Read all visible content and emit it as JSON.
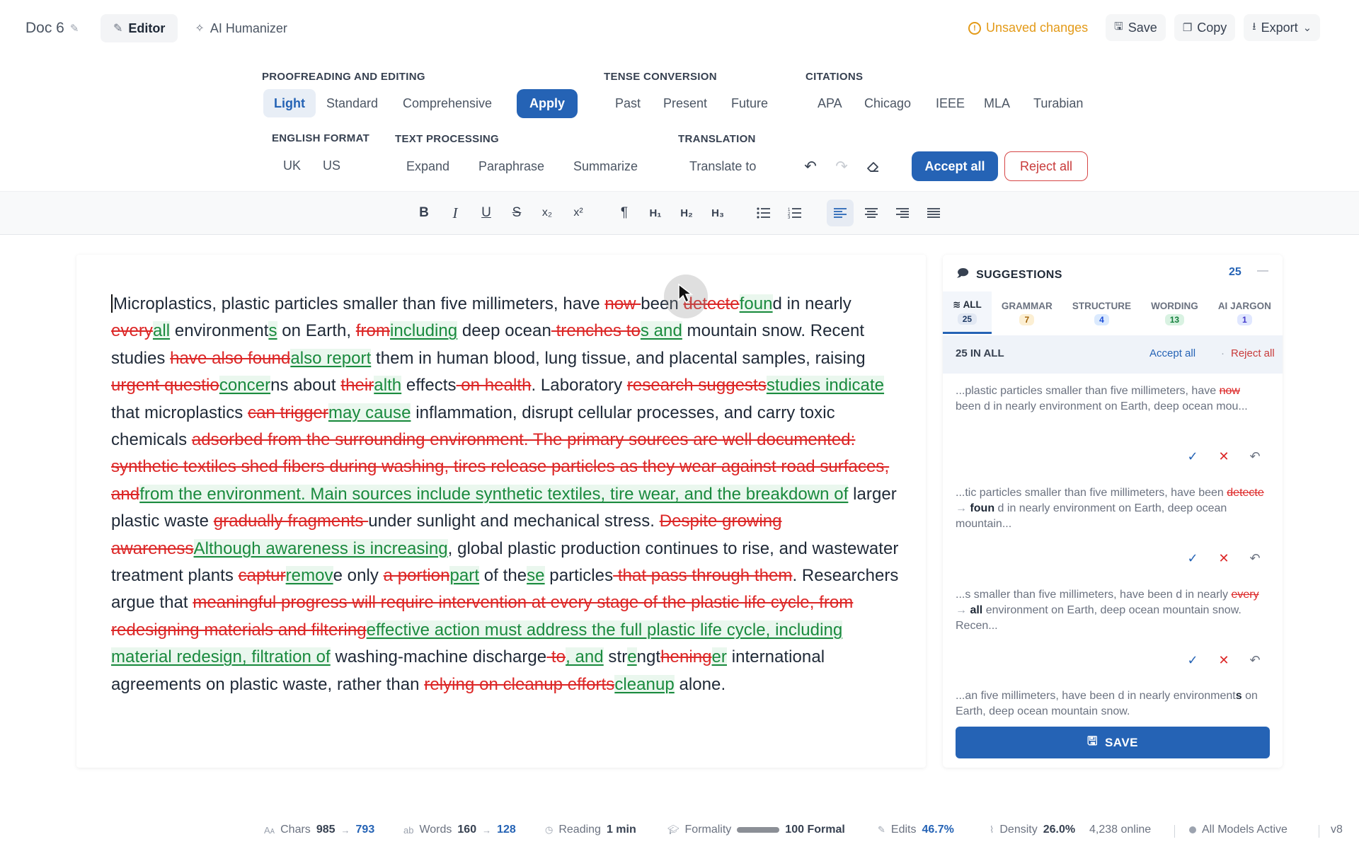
{
  "header": {
    "doc_title": "Doc 6",
    "tabs": [
      {
        "label": "Editor",
        "icon": "pencil-icon",
        "active": true
      },
      {
        "label": "AI Humanizer",
        "icon": "sparkle-icon",
        "active": false
      }
    ],
    "unsaved": "Unsaved changes",
    "save": "Save",
    "copy": "Copy",
    "export": "Export"
  },
  "tools": {
    "proofreading": {
      "label": "PROOFREADING AND EDITING",
      "options": [
        "Light",
        "Standard",
        "Comprehensive"
      ],
      "selected": "Light",
      "apply": "Apply"
    },
    "tense": {
      "label": "TENSE CONVERSION",
      "options": [
        "Past",
        "Present",
        "Future"
      ]
    },
    "citations": {
      "label": "CITATIONS",
      "options": [
        "APA",
        "Chicago",
        "IEEE",
        "MLA",
        "Turabian"
      ]
    },
    "english_format": {
      "label": "ENGLISH FORMAT",
      "options": [
        "UK",
        "US"
      ]
    },
    "text_processing": {
      "label": "TEXT PROCESSING",
      "options": [
        "Expand",
        "Paraphrase",
        "Summarize"
      ]
    },
    "translation": {
      "label": "TRANSLATION",
      "option": "Translate to"
    },
    "accept_all": "Accept all",
    "reject_all": "Reject all"
  },
  "format_toolbar": {
    "items": [
      "bold",
      "italic",
      "underline",
      "strikethrough",
      "subscript",
      "superscript",
      "paragraph",
      "H1",
      "H2",
      "H3",
      "bullet-list",
      "numbered-list",
      "align-left",
      "align-center",
      "align-right",
      "justify"
    ],
    "active": "align-left"
  },
  "document": {
    "segments": [
      {
        "t": "Microplastics, plastic particles smaller than five millimeters, have "
      },
      {
        "d": "now "
      },
      {
        "t": "been "
      },
      {
        "d": "detecte"
      },
      {
        "i": "foun"
      },
      {
        "t": "d in nearly "
      },
      {
        "d": "every"
      },
      {
        "i": "all"
      },
      {
        "t": " environment"
      },
      {
        "i": "s"
      },
      {
        "t": " on Earth, "
      },
      {
        "d": "from"
      },
      {
        "i": "including"
      },
      {
        "t": " deep ocean"
      },
      {
        "d": " trenches to"
      },
      {
        "i": "s and"
      },
      {
        "t": " mountain snow. Recent studies "
      },
      {
        "d": "have also found"
      },
      {
        "i": "also report"
      },
      {
        "t": " them in human blood, lung tissue, and placental samples, raising "
      },
      {
        "d": "urgent questio"
      },
      {
        "i": "concer"
      },
      {
        "t": "ns about "
      },
      {
        "d": "their"
      },
      {
        "i": "alth"
      },
      {
        "t": " effects"
      },
      {
        "d": " on health"
      },
      {
        "t": ". Laboratory "
      },
      {
        "d": "research suggests"
      },
      {
        "i": "studies indicate"
      },
      {
        "t": " that microplastics "
      },
      {
        "d": "can trigger"
      },
      {
        "i": "may cause"
      },
      {
        "t": " inflammation, disrupt cellular processes, and carry toxic chemicals "
      },
      {
        "d": "adsorbed from the surrounding environment. The primary sources are well documented: synthetic textiles shed fibers during washing, tires release particles as they wear against road surfaces, and"
      },
      {
        "i": "from the environment. Main sources include synthetic textiles, tire wear, and the breakdown of"
      },
      {
        "t": " larger plastic waste "
      },
      {
        "d": "gradually fragments "
      },
      {
        "t": "under sunlight and mechanical stress. "
      },
      {
        "d": "Despite growing awareness"
      },
      {
        "i": "Although awareness is increasing"
      },
      {
        "t": ", global plastic production continues to rise, and wastewater treatment plants "
      },
      {
        "d": "captur"
      },
      {
        "i": "remov"
      },
      {
        "t": "e only "
      },
      {
        "d": "a portion"
      },
      {
        "i": "part"
      },
      {
        "t": " of the"
      },
      {
        "i": "se"
      },
      {
        "t": " particles"
      },
      {
        "d": " that pass through them"
      },
      {
        "t": ". Researchers argue that "
      },
      {
        "d": "meaningful progress will require intervention at every stage of the plastic life cycle, from redesigning materials and filtering"
      },
      {
        "i": "effective action must address the full plastic life cycle, including material redesign, filtration of"
      },
      {
        "t": " washing-machine discharge"
      },
      {
        "d": " to"
      },
      {
        "i": ", and"
      },
      {
        "t": " str"
      },
      {
        "i": "e"
      },
      {
        "t": "ngt"
      },
      {
        "d": "hening"
      },
      {
        "i": "er"
      },
      {
        "t": " international agreements on plastic waste, rather than "
      },
      {
        "d": "relying on cleanup efforts"
      },
      {
        "i": "cleanup"
      },
      {
        "t": " alone."
      }
    ]
  },
  "suggestions": {
    "title": "SUGGESTIONS",
    "count": "25",
    "tabs": [
      {
        "label": "ALL",
        "count": "25",
        "active": true
      },
      {
        "label": "GRAMMAR",
        "count": "7"
      },
      {
        "label": "STRUCTURE",
        "count": "4"
      },
      {
        "label": "WORDING",
        "count": "13"
      },
      {
        "label": "AI JARGON",
        "count": "1"
      }
    ],
    "summary": "25 IN ALL",
    "accept_all": "Accept all",
    "reject_all": "Reject all",
    "cards": [
      {
        "pre": "...plastic particles smaller than five millimeters, have ",
        "old": "now ",
        "new": "",
        "post": "been d in nearly environment on Earth, deep ocean mou..."
      },
      {
        "pre": "...tic particles smaller than five millimeters, have been ",
        "old": "detecte",
        "new": "foun",
        "post": "d in nearly environment on Earth, deep ocean mountain..."
      },
      {
        "pre": "...s smaller than five millimeters, have been d in nearly ",
        "old": "every",
        "new": "all",
        "post": "environment on Earth, deep ocean mountain snow. Recen..."
      },
      {
        "pre": "...an five millimeters, have been d in nearly environment",
        "old": "",
        "new": "s",
        "post": "on Earth, deep ocean mountain snow."
      }
    ],
    "save": "SAVE"
  },
  "status": {
    "chars_label": "Chars",
    "chars_from": "985",
    "chars_to": "793",
    "words_label": "Words",
    "words_from": "160",
    "words_to": "128",
    "reading_label": "Reading",
    "reading_value": "1 min",
    "formality_label": "Formality",
    "formality_value": "100 Formal",
    "edits_label": "Edits",
    "edits_value": "46.7%",
    "density_label": "Density",
    "density_value": "26.0%",
    "online": "4,238 online",
    "models": "All Models Active",
    "version": "v8"
  }
}
